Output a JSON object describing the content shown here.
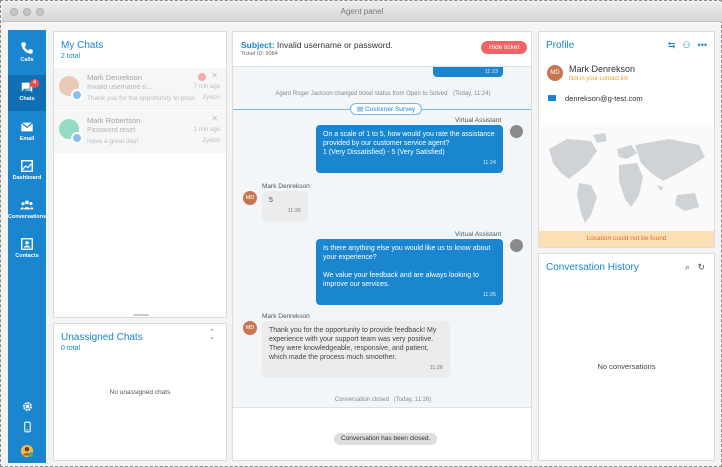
{
  "window": {
    "title": "Agent panel"
  },
  "nav": {
    "calls": "Calls",
    "chats": "Chats",
    "chats_badge": "4",
    "email": "Email",
    "dashboard": "Dashboard",
    "conversations": "Conversations",
    "contacts": "Contacts"
  },
  "my_chats": {
    "title": "My Chats",
    "total": "2 total",
    "items": [
      {
        "name": "Mark Denrekson",
        "line1": "Invalid username o...",
        "line2": "Thank you for the opportunity to provi...",
        "time": "7 min ago",
        "org": "Zyxion",
        "avatar_color": "#d9a07e"
      },
      {
        "name": "Mark Robertson",
        "line1": "Password reset",
        "line2": "Have a great day!",
        "time": "1 min ago",
        "org": "Zyxion",
        "avatar_color": "#3fbf8f"
      }
    ]
  },
  "unassigned": {
    "title": "Unassigned Chats",
    "total": "0 total",
    "empty": "No unassigned chats"
  },
  "conversation": {
    "subject_label": "Subject:",
    "subject": "Invalid username or password.",
    "ticket": "Ticket ID: 9084",
    "hide_ticket": "Hide ticket",
    "top_time": "11:23",
    "status_change": "Agent Roger Jackson changed ticket status from Open to Solved",
    "status_change_time": "(Today, 11:24)",
    "survey_label": "Customer Survey",
    "va_name": "Virtual Assistant",
    "customer_name": "Mark Denrekson",
    "customer_initials": "MD",
    "msg1": "On a scale of 1 to 5, how would you rate the assistance provided by our customer service agent?\n1 (Very Dissatisfied) - 5 (Very Satisfied)",
    "msg1_time": "11:24",
    "msg2": "5",
    "msg2_time": "11:26",
    "msg3": "Is there anything else you would like us to know about your experience?\n\nWe value your feedback and are always looking to improve our services.",
    "msg3_time": "11:26",
    "msg4": "Thank you for the opportunity to provide feedback! My experience with your support team was very positive. They were knowledgeable, responsive, and patient, which made the process much smoother.",
    "msg4_time": "11:26",
    "closed_note": "Conversation closed",
    "closed_note_time": "(Today, 11:26)",
    "closed_banner": "Conversation has been closed."
  },
  "profile": {
    "title": "Profile",
    "initials": "MD",
    "name": "Mark Denrekson",
    "contact_status": "Not in your contact list",
    "email": "denrekson@g-test.com",
    "location_error": "Location could not be found"
  },
  "history": {
    "title": "Conversation History",
    "empty": "No conversations"
  },
  "colors": {
    "primary": "#1a86d0",
    "danger": "#f06464",
    "warning_bg": "#fbe0b6",
    "warning_text": "#e06b2d"
  }
}
